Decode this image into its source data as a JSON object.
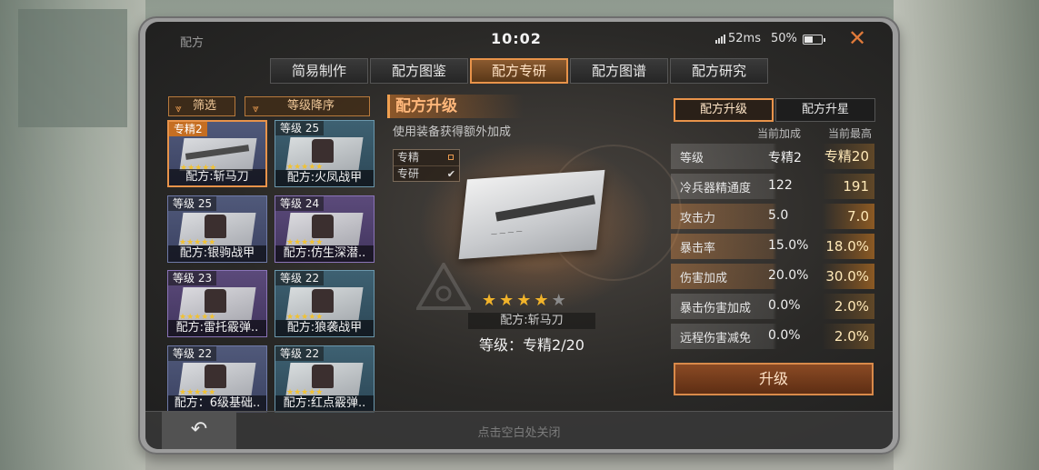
{
  "statusbar": {
    "title": "配方",
    "time": "10:02",
    "ping": "52ms",
    "battery": "50%",
    "close_icon": "close-icon"
  },
  "tabs": [
    {
      "label": "简易制作",
      "active": false
    },
    {
      "label": "配方图鉴",
      "active": false
    },
    {
      "label": "配方专研",
      "active": true
    },
    {
      "label": "配方图谱",
      "active": false
    },
    {
      "label": "配方研究",
      "active": false
    }
  ],
  "filters": {
    "filter_label": "筛选",
    "sort_label": "等级降序"
  },
  "cards": [
    {
      "level": "专精2",
      "name": "配方:斩马刀",
      "stars": "★★★★★",
      "selected": true
    },
    {
      "level": "等级 25",
      "name": "配方:火凤战甲",
      "stars": "★★★★★",
      "selected": false
    },
    {
      "level": "等级 25",
      "name": "配方:银驹战甲",
      "stars": "★★★★★",
      "selected": false
    },
    {
      "level": "等级 24",
      "name": "配方:仿生深潜..",
      "stars": "★★★★★",
      "selected": false
    },
    {
      "level": "等级 23",
      "name": "配方:雷托霰弹..",
      "stars": "★★★★★",
      "selected": false
    },
    {
      "level": "等级 22",
      "name": "配方:狼袭战甲",
      "stars": "★★★★★",
      "selected": false
    },
    {
      "level": "等级 22",
      "name": "配方：6级基础..",
      "stars": "★★★★★",
      "selected": false
    },
    {
      "level": "等级 22",
      "name": "配方:红点霰弹..",
      "stars": "★★★★★",
      "selected": false
    }
  ],
  "center": {
    "section_title": "配方升级",
    "subtitle": "使用装备获得额外加成",
    "mode_options": [
      "专精",
      "专研"
    ],
    "stars_on": 4,
    "stars_total": 5,
    "recipe_name": "配方:斩马刀",
    "recipe_level": "等级：专精2/20"
  },
  "right": {
    "tabs": [
      "配方升级",
      "配方升星"
    ],
    "col_current": "当前加成",
    "col_max": "当前最高",
    "stats": [
      {
        "label": "等级",
        "current": "专精2",
        "max": "专精20",
        "highlight": false
      },
      {
        "label": "冷兵器精通度",
        "current": "122",
        "max": "191",
        "highlight": false
      },
      {
        "label": "攻击力",
        "current": "5.0",
        "max": "7.0",
        "highlight": true
      },
      {
        "label": "暴击率",
        "current": "15.0%",
        "max": "18.0%",
        "highlight": true
      },
      {
        "label": "伤害加成",
        "current": "20.0%",
        "max": "30.0%",
        "highlight": true
      },
      {
        "label": "暴击伤害加成",
        "current": "0.0%",
        "max": "2.0%",
        "highlight": false
      },
      {
        "label": "远程伤害减免",
        "current": "0.0%",
        "max": "2.0%",
        "highlight": false
      }
    ],
    "upgrade_label": "升级"
  },
  "bottom": {
    "back_icon": "back-arrow-icon",
    "hint": "点击空白处关闭"
  }
}
